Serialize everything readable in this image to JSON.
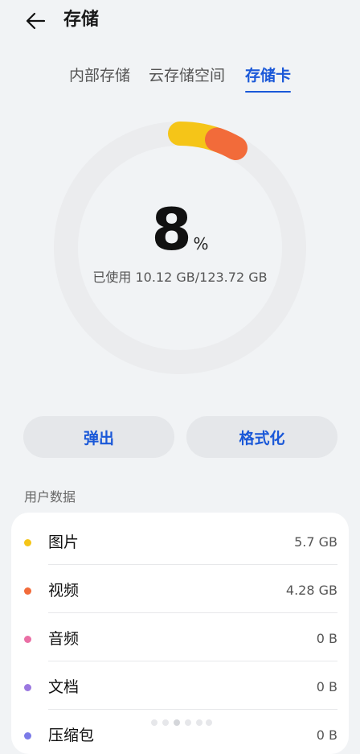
{
  "header": {
    "title": "存储"
  },
  "tabs": [
    {
      "label": "内部存储",
      "active": false
    },
    {
      "label": "云存储空间",
      "active": false
    },
    {
      "label": "存储卡",
      "active": true
    }
  ],
  "usage": {
    "percent": "8",
    "percent_unit": "%",
    "used_text": "已使用 10.12 GB/123.72 GB",
    "percent_value": 8
  },
  "actions": {
    "eject_label": "弹出",
    "format_label": "格式化"
  },
  "user_data": {
    "section_label": "用户数据",
    "items": [
      {
        "label": "图片",
        "value": "5.7 GB",
        "color": "#f5c518"
      },
      {
        "label": "视频",
        "value": "4.28 GB",
        "color": "#f26b3a"
      },
      {
        "label": "音频",
        "value": "0 B",
        "color": "#ea6fa5"
      },
      {
        "label": "文档",
        "value": "0 B",
        "color": "#9b78e0"
      },
      {
        "label": "压缩包",
        "value": "0 B",
        "color": "#7b7be8"
      }
    ]
  },
  "colors": {
    "accent": "#1a58d8",
    "ring_track": "#ebecee",
    "segment_images": "#f5c518",
    "segment_video": "#f26b3a"
  }
}
